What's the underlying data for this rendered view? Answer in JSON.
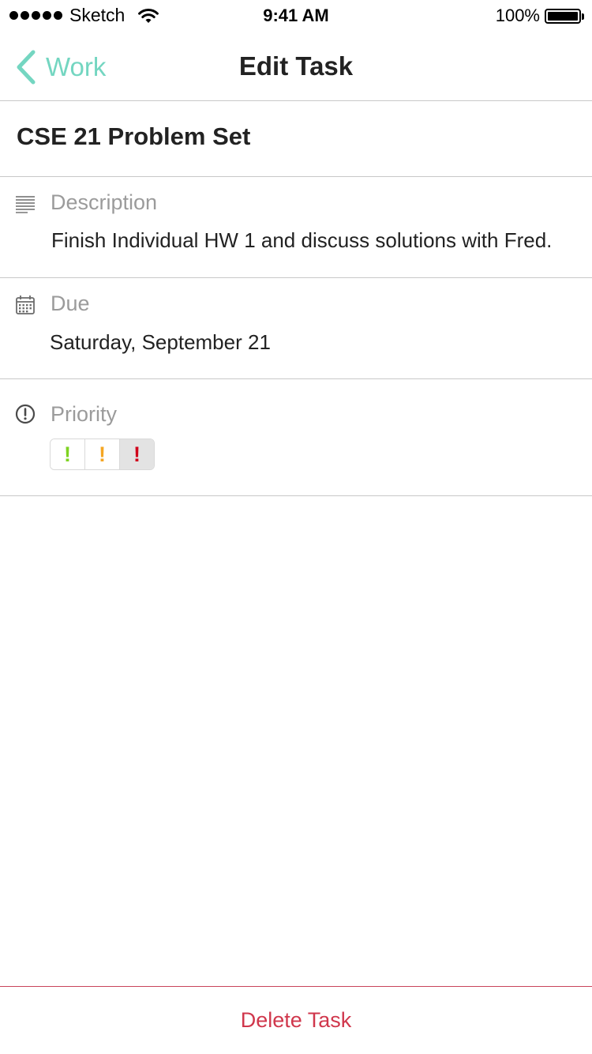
{
  "status_bar": {
    "carrier": "Sketch",
    "time": "9:41 AM",
    "battery_percent": "100%",
    "icons": [
      "signal-dots-icon",
      "wifi-icon",
      "battery-icon"
    ]
  },
  "nav": {
    "back_label": "Work",
    "back_icon": "chevron-left-icon",
    "title": "Edit Task"
  },
  "task": {
    "title": "CSE 21 Problem Set"
  },
  "description": {
    "icon": "text-lines-icon",
    "label": "Description",
    "value": "Finish Individual HW 1 and discuss solutions with Fred."
  },
  "due": {
    "icon": "calendar-icon",
    "label": "Due",
    "value": "Saturday, September 21"
  },
  "priority": {
    "icon": "alert-circle-icon",
    "label": "Priority",
    "options": [
      {
        "glyph": "!",
        "level": "low",
        "color": "#7ed321"
      },
      {
        "glyph": "!",
        "level": "medium",
        "color": "#f5a623"
      },
      {
        "glyph": "!",
        "level": "high",
        "color": "#d0021b"
      }
    ],
    "selected": "high"
  },
  "delete": {
    "label": "Delete Task"
  },
  "colors": {
    "accent": "#74d6c1",
    "delete": "#d0374c",
    "divider": "#c8c8c8",
    "label_gray": "#9b9b9b"
  }
}
